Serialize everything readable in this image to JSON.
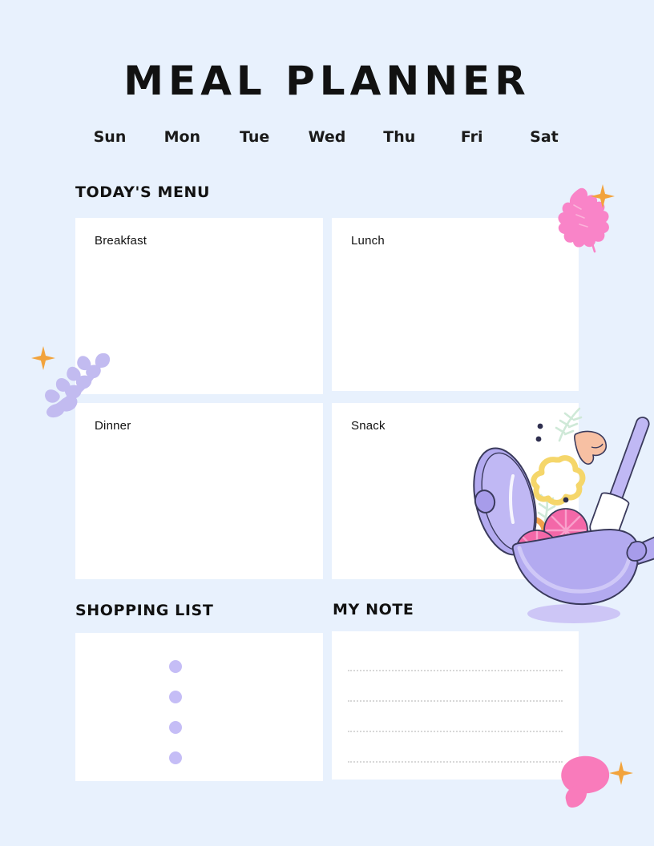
{
  "document": {
    "title": "MEAL PLANNER",
    "background_color": "#e8f1fd",
    "card_color": "#ffffff",
    "text_color": "#111111"
  },
  "weekdays": [
    {
      "label": "Sun"
    },
    {
      "label": "Mon"
    },
    {
      "label": "Tue"
    },
    {
      "label": "Wed"
    },
    {
      "label": "Thu"
    },
    {
      "label": "Fri"
    },
    {
      "label": "Sat"
    }
  ],
  "sections": {
    "todays_menu": {
      "header": "TODAY'S MENU"
    },
    "shopping_list": {
      "header": "SHOPPING LIST",
      "bullet_color": "#c5bdf6",
      "bullet_count": 4
    },
    "my_note": {
      "header": "MY NOTE",
      "line_color": "#d8d8d8",
      "line_count": 4
    }
  },
  "meal_cards": [
    {
      "label": "Breakfast",
      "value": ""
    },
    {
      "label": "Lunch",
      "value": ""
    },
    {
      "label": "Dinner",
      "value": ""
    },
    {
      "label": "Snack",
      "value": ""
    }
  ],
  "shopping_items": [
    {
      "value": ""
    },
    {
      "value": ""
    },
    {
      "value": ""
    },
    {
      "value": ""
    }
  ],
  "note_lines": [
    {
      "value": ""
    },
    {
      "value": ""
    },
    {
      "value": ""
    },
    {
      "value": ""
    }
  ],
  "decorations": {
    "leaf": {
      "name": "pink-leaf",
      "color": "#f984c8"
    },
    "fern": {
      "name": "purple-fern",
      "color": "#c2bbf0"
    },
    "mushroom": {
      "name": "pink-mushroom",
      "color": "#f97bbb"
    },
    "sparkle": {
      "color": "#f2a33c"
    },
    "pan": {
      "name": "cooking-pan-illustration",
      "pan_color": "#b3aaf0",
      "pan_light": "#cfc8f7",
      "tomato_color": "#f368a8",
      "pepper_color": "#f5d66a",
      "mushroom_color": "#f7c0a3",
      "herb_color": "#cfe9d8",
      "outline_color": "#2f2f4f"
    }
  }
}
